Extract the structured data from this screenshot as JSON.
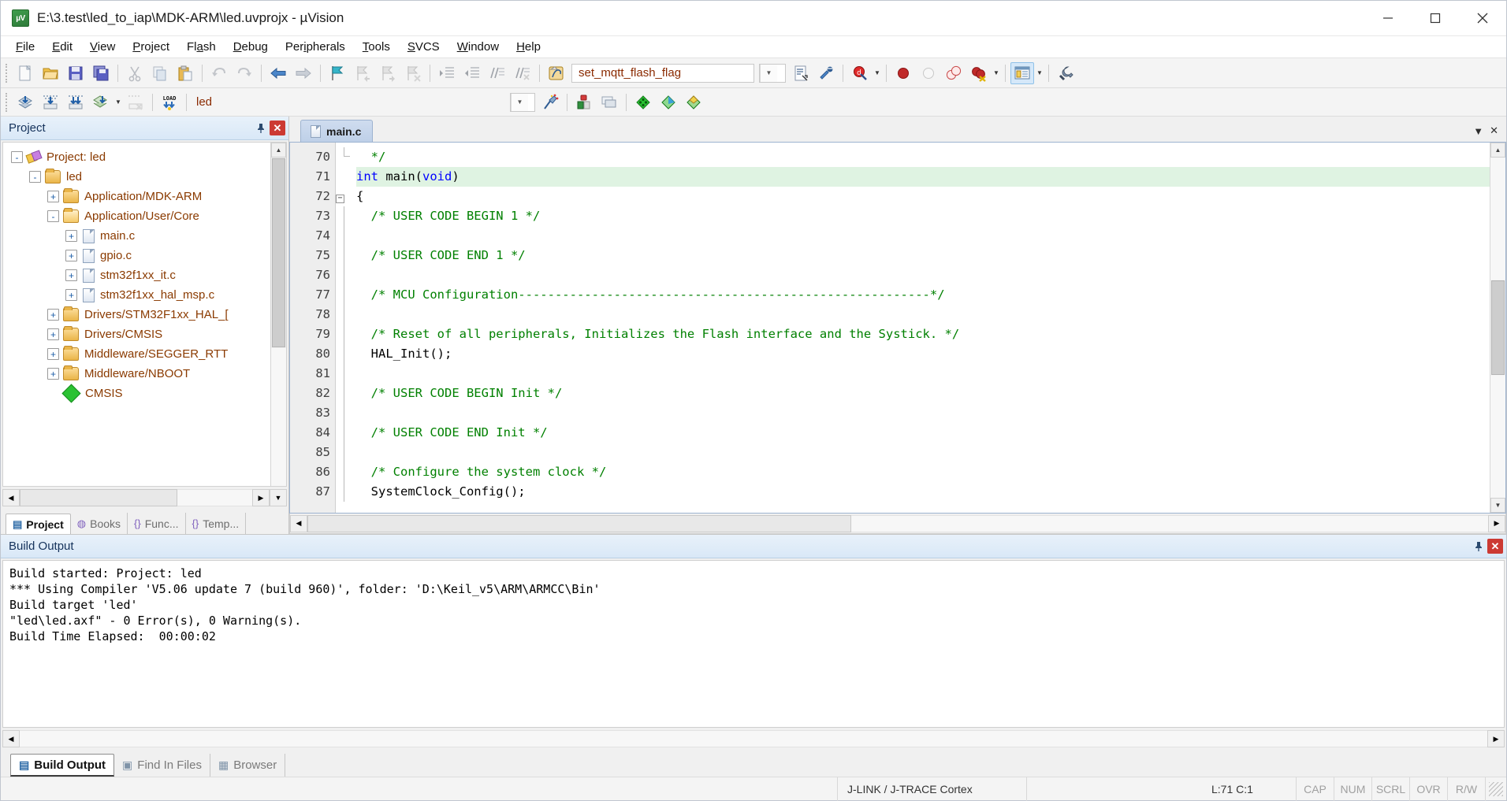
{
  "window": {
    "title": "E:\\3.test\\led_to_iap\\MDK-ARM\\led.uvprojx - µVision",
    "app_icon": "uvision-logo-icon",
    "minimize": "minimize-icon",
    "maximize": "maximize-icon",
    "close": "close-icon"
  },
  "menu": [
    {
      "label": "File",
      "accel": "F"
    },
    {
      "label": "Edit",
      "accel": "E"
    },
    {
      "label": "View",
      "accel": "V"
    },
    {
      "label": "Project",
      "accel": "P"
    },
    {
      "label": "Flash",
      "accel": "a"
    },
    {
      "label": "Debug",
      "accel": "D"
    },
    {
      "label": "Peripherals",
      "accel": "i"
    },
    {
      "label": "Tools",
      "accel": "T"
    },
    {
      "label": "SVCS",
      "accel": "S"
    },
    {
      "label": "Window",
      "accel": "W"
    },
    {
      "label": "Help",
      "accel": "H"
    }
  ],
  "toolbar_file": {
    "buttons": [
      "new-file-icon",
      "open-file-icon",
      "save-icon",
      "save-all-icon",
      "cut-icon",
      "copy-icon",
      "paste-icon",
      "undo-icon",
      "redo-icon",
      "navigate-back-icon",
      "navigate-forward-icon",
      "bookmark-toggle-icon",
      "bookmark-prev-icon",
      "bookmark-next-icon",
      "bookmark-clear-icon",
      "indent-icon",
      "outdent-icon",
      "comment-icon",
      "uncomment-icon",
      "goto-definition-icon"
    ],
    "function_combo_value": "set_mqtt_flash_flag",
    "after_combo": [
      "insert-file-icon",
      "configure-icon"
    ],
    "debug": [
      "start-debug-icon"
    ],
    "breakpoints": [
      "insert-breakpoint-icon",
      "disable-breakpoint-icon",
      "disable-all-breakpoints-icon",
      "kill-all-breakpoints-icon"
    ],
    "window_button": "manage-windows-icon",
    "settings_button": "configure-target-icon"
  },
  "toolbar_build": {
    "buttons": [
      "translate-file-icon",
      "build-target-icon",
      "rebuild-all-icon",
      "batch-build-icon",
      "stop-build-icon",
      "download-to-flash-icon"
    ],
    "target_combo_value": "led",
    "after": [
      "target-options-icon",
      "manage-runtime-env-icon"
    ],
    "right": [
      "options-for-target-icon",
      "multi-project-icon",
      "pack-installer-icon",
      "manage-project-items-icon",
      "pack-icon"
    ]
  },
  "project_panel": {
    "caption": "Project",
    "pin_icon": "pin-icon",
    "close_icon": "close-icon",
    "tree": [
      {
        "label": "Project: led",
        "indent": 0,
        "expander": "-",
        "icon": "project-icon"
      },
      {
        "label": "led",
        "indent": 1,
        "expander": "-",
        "icon": "target-folder-icon"
      },
      {
        "label": "Application/MDK-ARM",
        "indent": 2,
        "expander": "+",
        "icon": "folder-icon"
      },
      {
        "label": "Application/User/Core",
        "indent": 2,
        "expander": "-",
        "icon": "folder-open-icon"
      },
      {
        "label": "main.c",
        "indent": 3,
        "expander": "+",
        "icon": "c-file-icon"
      },
      {
        "label": "gpio.c",
        "indent": 3,
        "expander": "+",
        "icon": "c-file-icon"
      },
      {
        "label": "stm32f1xx_it.c",
        "indent": 3,
        "expander": "+",
        "icon": "c-file-icon"
      },
      {
        "label": "stm32f1xx_hal_msp.c",
        "indent": 3,
        "expander": "+",
        "icon": "c-file-icon"
      },
      {
        "label": "Drivers/STM32F1xx_HAL_[",
        "indent": 2,
        "expander": "+",
        "icon": "folder-icon"
      },
      {
        "label": "Drivers/CMSIS",
        "indent": 2,
        "expander": "+",
        "icon": "folder-icon"
      },
      {
        "label": "Middleware/SEGGER_RTT",
        "indent": 2,
        "expander": "+",
        "icon": "folder-icon"
      },
      {
        "label": "Middleware/NBOOT",
        "indent": 2,
        "expander": "+",
        "icon": "folder-icon"
      },
      {
        "label": "CMSIS",
        "indent": 2,
        "expander": "",
        "icon": "cmsis-icon"
      }
    ],
    "tabs": [
      {
        "label": "Project",
        "icon": "project-tab-icon",
        "active": true
      },
      {
        "label": "Books",
        "icon": "books-tab-icon",
        "active": false
      },
      {
        "label": "Func...",
        "icon": "functions-tab-icon",
        "active": false
      },
      {
        "label": "Temp...",
        "icon": "templates-tab-icon",
        "active": false
      }
    ]
  },
  "editor": {
    "tabs": [
      {
        "label": "main.c",
        "icon": "c-file-icon",
        "active": true
      }
    ],
    "tab_menu_icon": "chevron-down-icon",
    "tab_close_icon": "close-icon",
    "first_line": 70,
    "highlight_line": 71,
    "lines": [
      {
        "n": 70,
        "fold": "corner",
        "tokens": [
          {
            "t": "  */",
            "c": "cm"
          }
        ]
      },
      {
        "n": 71,
        "fold": "",
        "tokens": [
          {
            "t": "int ",
            "c": "kw"
          },
          {
            "t": "main(",
            "c": "tx"
          },
          {
            "t": "void",
            "c": "kw"
          },
          {
            "t": ")",
            "c": "tx"
          }
        ]
      },
      {
        "n": 72,
        "fold": "box",
        "tokens": [
          {
            "t": "{",
            "c": "tx"
          }
        ]
      },
      {
        "n": 73,
        "fold": "bar",
        "tokens": [
          {
            "t": "  /* USER CODE BEGIN 1 */",
            "c": "cm"
          }
        ]
      },
      {
        "n": 74,
        "fold": "bar",
        "tokens": [
          {
            "t": "",
            "c": "tx"
          }
        ]
      },
      {
        "n": 75,
        "fold": "bar",
        "tokens": [
          {
            "t": "  /* USER CODE END 1 */",
            "c": "cm"
          }
        ]
      },
      {
        "n": 76,
        "fold": "bar",
        "tokens": [
          {
            "t": "",
            "c": "tx"
          }
        ]
      },
      {
        "n": 77,
        "fold": "bar",
        "tokens": [
          {
            "t": "  /* MCU Configuration--------------------------------------------------------*/",
            "c": "cm"
          }
        ]
      },
      {
        "n": 78,
        "fold": "bar",
        "tokens": [
          {
            "t": "",
            "c": "tx"
          }
        ]
      },
      {
        "n": 79,
        "fold": "bar",
        "tokens": [
          {
            "t": "  /* Reset of all peripherals, Initializes the Flash interface and the Systick. */",
            "c": "cm"
          }
        ]
      },
      {
        "n": 80,
        "fold": "bar",
        "tokens": [
          {
            "t": "  HAL_Init();",
            "c": "tx"
          }
        ]
      },
      {
        "n": 81,
        "fold": "bar",
        "tokens": [
          {
            "t": "",
            "c": "tx"
          }
        ]
      },
      {
        "n": 82,
        "fold": "bar",
        "tokens": [
          {
            "t": "  /* USER CODE BEGIN Init */",
            "c": "cm"
          }
        ]
      },
      {
        "n": 83,
        "fold": "bar",
        "tokens": [
          {
            "t": "",
            "c": "tx"
          }
        ]
      },
      {
        "n": 84,
        "fold": "bar",
        "tokens": [
          {
            "t": "  /* USER CODE END Init */",
            "c": "cm"
          }
        ]
      },
      {
        "n": 85,
        "fold": "bar",
        "tokens": [
          {
            "t": "",
            "c": "tx"
          }
        ]
      },
      {
        "n": 86,
        "fold": "bar",
        "tokens": [
          {
            "t": "  /* Configure the system clock */",
            "c": "cm"
          }
        ]
      },
      {
        "n": 87,
        "fold": "bar",
        "tokens": [
          {
            "t": "  SystemClock_Config();",
            "c": "tx"
          }
        ]
      }
    ]
  },
  "build_output": {
    "caption": "Build Output",
    "pin_icon": "pin-icon",
    "close_icon": "close-icon",
    "lines": [
      "Build started: Project: led",
      "*** Using Compiler 'V5.06 update 7 (build 960)', folder: 'D:\\Keil_v5\\ARM\\ARMCC\\Bin'",
      "Build target 'led'",
      "\"led\\led.axf\" - 0 Error(s), 0 Warning(s).",
      "Build Time Elapsed:  00:00:02"
    ],
    "tabs": [
      {
        "label": "Build Output",
        "icon": "build-output-icon",
        "active": true
      },
      {
        "label": "Find In Files",
        "icon": "find-in-files-icon",
        "active": false
      },
      {
        "label": "Browser",
        "icon": "browser-icon",
        "active": false
      }
    ]
  },
  "statusbar": {
    "debugger": "J-LINK / J-TRACE Cortex",
    "position": "L:71 C:1",
    "indicators": [
      "CAP",
      "NUM",
      "SCRL",
      "OVR",
      "R/W"
    ],
    "resize_grip": "resize-grip-icon"
  },
  "colors": {
    "comment_green": "#008000",
    "keyword_blue": "#0000ff",
    "tree_text": "#8a3a00",
    "caption_blue": "#15325b",
    "highlight_line": "#dff3e2",
    "close_red": "#cc3a33"
  }
}
